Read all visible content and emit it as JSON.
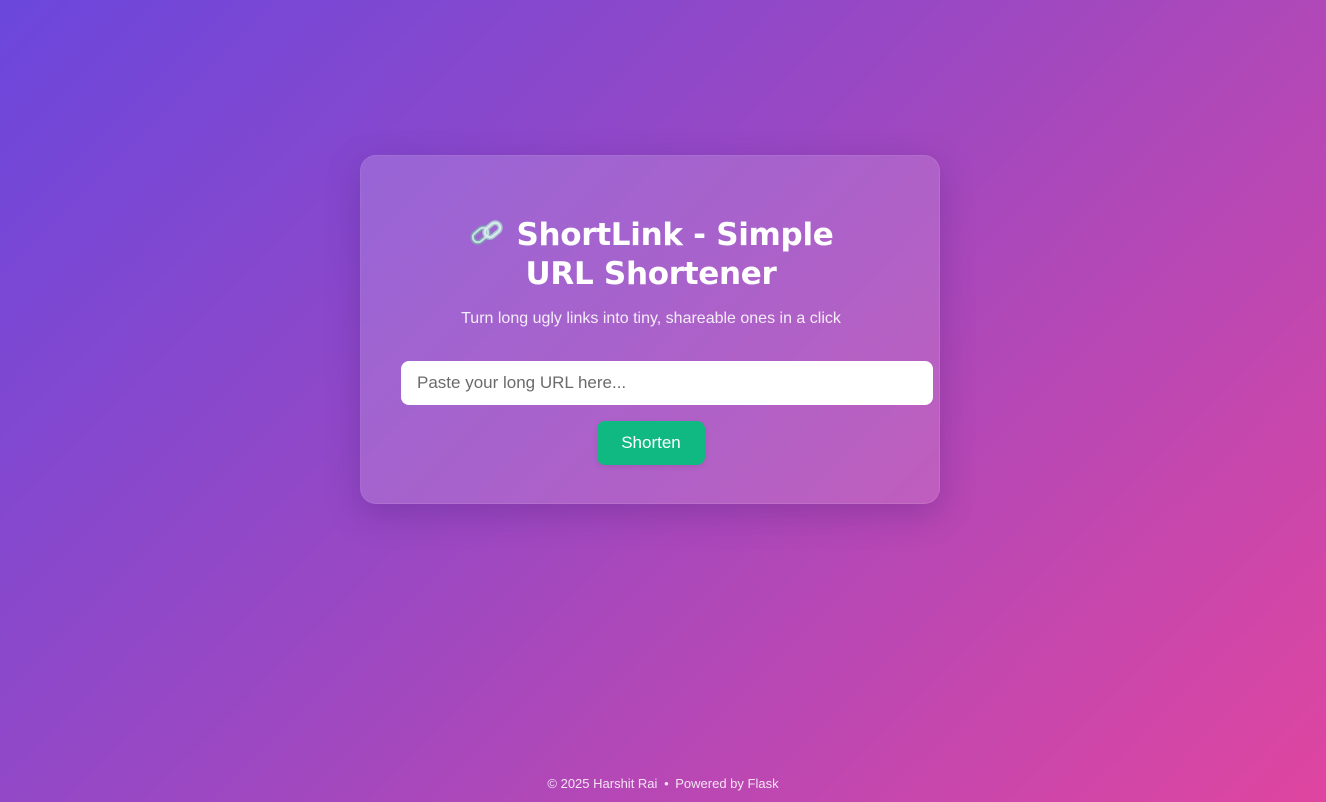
{
  "header": {
    "icon": "link-icon",
    "title": "ShortLink - Simple URL Shortener",
    "subtitle": "Turn long ugly links into tiny, shareable ones in a click"
  },
  "form": {
    "url_value": "",
    "url_placeholder": "Paste your long URL here...",
    "submit_label": "Shorten"
  },
  "footer": {
    "copyright": "© 2025 Harshit Rai",
    "separator": "•",
    "powered_by": "Powered by Flask"
  },
  "colors": {
    "button": "#10b981",
    "gradient_start": "#6b47dc",
    "gradient_end": "#df45a0"
  }
}
